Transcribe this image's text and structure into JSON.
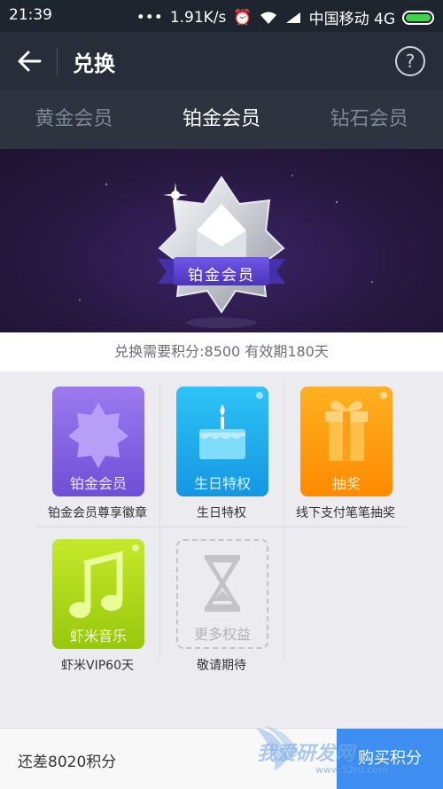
{
  "status_bar": {
    "time": "21:39",
    "speed": "1.91K/s",
    "carrier": "中国移动 4G"
  },
  "app_bar": {
    "title": "兑换"
  },
  "tabs": [
    {
      "label": "黄金会员",
      "active": false
    },
    {
      "label": "铂金会员",
      "active": true
    },
    {
      "label": "钻石会员",
      "active": false
    }
  ],
  "banner": {
    "badge_text": "铂金会员"
  },
  "requirement": "兑换需要积分:8500   有效期180天",
  "benefits": [
    {
      "tile_label": "铂金会员",
      "caption": "铂金会员尊享徽章",
      "color_top": "#9c7bf0",
      "color_bottom": "#6e4fd6",
      "icon": "badge-icon"
    },
    {
      "tile_label": "生日特权",
      "caption": "生日特权",
      "color_top": "#2ec4f6",
      "color_bottom": "#1596e2",
      "icon": "cake-icon"
    },
    {
      "tile_label": "抽奖",
      "caption": "线下支付笔笔抽奖",
      "color_top": "#ffb020",
      "color_bottom": "#ff8a00",
      "icon": "gift-icon"
    },
    {
      "tile_label": "虾米音乐",
      "caption": "虾米VIP60天",
      "color_top": "#c6e82a",
      "color_bottom": "#97c80c",
      "icon": "music-note-icon"
    },
    {
      "tile_label": "更多权益",
      "caption": "敬请期待",
      "icon": "hourglass-icon"
    }
  ],
  "bottom": {
    "remaining": "还差8020积分",
    "buy_label": "购买积分"
  },
  "watermark": {
    "text": "我爱研发网",
    "url": "www.52rd.com"
  }
}
